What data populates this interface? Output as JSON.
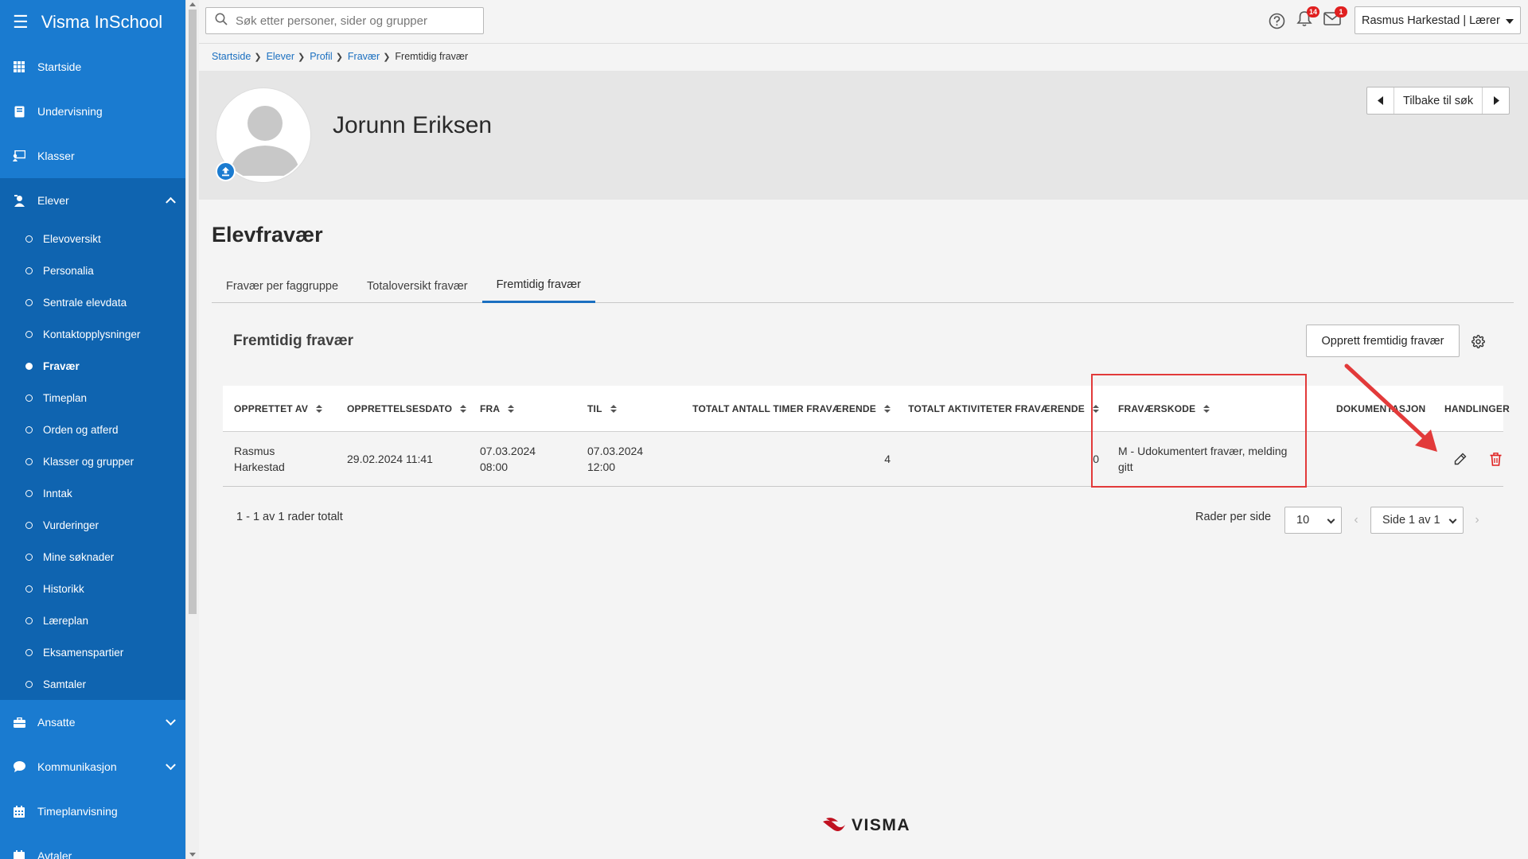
{
  "app": {
    "name": "Visma InSchool"
  },
  "sidebar": {
    "items": [
      {
        "label": "Startside",
        "icon": "grid-icon"
      },
      {
        "label": "Undervisning",
        "icon": "book-icon"
      },
      {
        "label": "Klasser",
        "icon": "classroom-icon"
      },
      {
        "label": "Elever",
        "icon": "student-icon",
        "expanded": true
      }
    ],
    "elever_sub": [
      {
        "label": "Elevoversikt",
        "active": false
      },
      {
        "label": "Personalia",
        "active": false
      },
      {
        "label": "Sentrale elevdata",
        "active": false
      },
      {
        "label": "Kontaktopplysninger",
        "active": false
      },
      {
        "label": "Fravær",
        "active": true
      },
      {
        "label": "Timeplan",
        "active": false
      },
      {
        "label": "Orden og atferd",
        "active": false
      },
      {
        "label": "Klasser og grupper",
        "active": false
      },
      {
        "label": "Inntak",
        "active": false
      },
      {
        "label": "Vurderinger",
        "active": false
      },
      {
        "label": "Mine søknader",
        "active": false
      },
      {
        "label": "Historikk",
        "active": false
      },
      {
        "label": "Læreplan",
        "active": false
      },
      {
        "label": "Eksamenspartier",
        "active": false
      },
      {
        "label": "Samtaler",
        "active": false
      }
    ],
    "bottom_items": [
      {
        "label": "Ansatte",
        "icon": "briefcase-icon"
      },
      {
        "label": "Kommunikasjon",
        "icon": "chat-icon"
      },
      {
        "label": "Timeplanvisning",
        "icon": "calendar-icon"
      },
      {
        "label": "Avtaler",
        "icon": "agreement-icon"
      }
    ]
  },
  "topbar": {
    "search_placeholder": "Søk etter personer, sider og grupper",
    "notifications_count": "14",
    "messages_count": "1",
    "user_label": "Rasmus Harkestad | Lærer"
  },
  "breadcrumb": {
    "items": [
      "Startside",
      "Elever",
      "Profil",
      "Fravær"
    ],
    "current": "Fremtidig fravær"
  },
  "profile": {
    "student_name": "Jorunn Eriksen",
    "back_label": "Tilbake til søk"
  },
  "page": {
    "title": "Elevfravær",
    "tabs": [
      {
        "label": "Fravær per faggruppe",
        "active": false
      },
      {
        "label": "Totaloversikt fravær",
        "active": false
      },
      {
        "label": "Fremtidig fravær",
        "active": true
      }
    ],
    "section_title": "Fremtidig fravær",
    "create_label": "Opprett fremtidig fravær"
  },
  "table": {
    "columns": [
      "OPPRETTET AV",
      "OPPRETTELSESDATO",
      "FRA",
      "TIL",
      "TOTALT ANTALL TIMER FRAVÆRENDE",
      "TOTALT AKTIVITETER FRAVÆRENDE",
      "FRAVÆRSKODE",
      "DOKUMENTASJON",
      "HANDLINGER"
    ],
    "rows": [
      {
        "created_by": "Rasmus Harkestad",
        "created_date": "29.02.2024 11:41",
        "from": "07.03.2024 08:00",
        "to": "07.03.2024 12:00",
        "hours": "4",
        "activities": "0",
        "code": "M - Udokumentert fravær, melding gitt",
        "documentation": ""
      }
    ]
  },
  "pagination": {
    "total_text": "1 - 1 av 1 rader totalt",
    "rows_per_page_label": "Rader per side",
    "rows_per_page_value": "10",
    "page_value": "Side 1 av 1"
  },
  "footer": {
    "logo_text": "VISMA"
  },
  "colors": {
    "sidebar": "#1a7bd0",
    "sidebar_group": "#0f64b0",
    "accent": "#1a6fc0",
    "annotation": "#e23a3a",
    "delete": "#e02020"
  }
}
